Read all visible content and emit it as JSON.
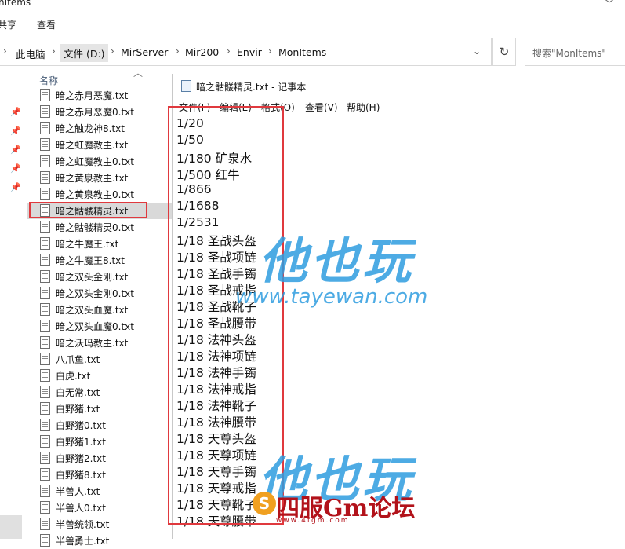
{
  "explorer": {
    "window_title": "nItems",
    "ribbon_tabs": [
      "共享",
      "查看"
    ],
    "breadcrumb": [
      "此电脑",
      "文件 (D:)",
      "MirServer",
      "Mir200",
      "Envir",
      "MonItems"
    ],
    "search_placeholder": "搜索\"MonItems\"",
    "column_header": "名称",
    "files": [
      "暗之赤月恶魔.txt",
      "暗之赤月恶魔0.txt",
      "暗之触龙神8.txt",
      "暗之虹魔教主.txt",
      "暗之虹魔教主0.txt",
      "暗之黄泉教主.txt",
      "暗之黄泉教主0.txt",
      "暗之骷髅精灵.txt",
      "暗之骷髅精灵0.txt",
      "暗之牛魔王.txt",
      "暗之牛魔王8.txt",
      "暗之双头金刚.txt",
      "暗之双头金刚0.txt",
      "暗之双头血魔.txt",
      "暗之双头血魔0.txt",
      "暗之沃玛教主.txt",
      "八爪鱼.txt",
      "白虎.txt",
      "白无常.txt",
      "白野猪.txt",
      "白野猪0.txt",
      "白野猪1.txt",
      "白野猪2.txt",
      "白野猪8.txt",
      "半兽人.txt",
      "半兽人0.txt",
      "半兽统领.txt",
      "半兽勇士.txt"
    ],
    "selected_index": 7
  },
  "notepad": {
    "title": "暗之骷髅精灵.txt - 记事本",
    "menu": [
      "文件(F)",
      "编辑(E)",
      "格式(O)",
      "查看(V)",
      "帮助(H)"
    ],
    "lines": [
      "1/20",
      "1/50",
      "1/180 矿泉水",
      "1/500 红牛",
      "1/866",
      "1/1688",
      "1/2531",
      "1/18 圣战头盔",
      "1/18 圣战项链",
      "1/18 圣战手镯",
      "1/18 圣战戒指",
      "1/18 圣战靴子",
      "1/18 圣战腰带",
      "1/18 法神头盔",
      "1/18 法神项链",
      "1/18 法神手镯",
      "1/18 法神戒指",
      "1/18 法神靴子",
      "1/18 法神腰带",
      "1/18 天尊头盔",
      "1/18 天尊项链",
      "1/18 天尊手镯",
      "1/18 天尊戒指",
      "1/18 天尊靴子",
      "1/18 天尊腰带"
    ]
  },
  "watermarks": {
    "brand": "他也玩",
    "url": "www.tayewan.com",
    "forum": "四服Gm论坛",
    "forum_logo": "S",
    "forum_url": "www.4fgm.com"
  },
  "icons": [
    "pin-icon",
    "file-icon",
    "notepad-icon",
    "refresh-icon",
    "sort-arrow-icon",
    "chevron-right-icon"
  ],
  "colors": {
    "highlight": "#e0393e",
    "selection": "#d9d9d9",
    "watermark_blue": "#2f9de0",
    "watermark_red": "#b2121a"
  }
}
